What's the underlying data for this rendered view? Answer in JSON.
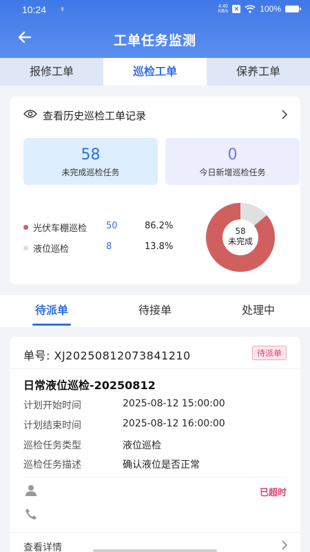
{
  "status_bar": {
    "time": "10:24",
    "symbol": "♆",
    "net_speed_value": "4.40",
    "net_speed_unit": "KB/s",
    "battery": "100%"
  },
  "header": {
    "title": "工单任务监测"
  },
  "top_tabs": [
    {
      "label": "报修工单",
      "active": false
    },
    {
      "label": "巡检工单",
      "active": true
    },
    {
      "label": "保养工单",
      "active": false
    }
  ],
  "overview": {
    "history_link": "查看历史巡检工单记录",
    "stats": [
      {
        "value": "58",
        "label": "未完成巡检任务"
      },
      {
        "value": "0",
        "label": "今日新增巡检任务"
      }
    ],
    "legend": [
      {
        "name": "光伏车棚巡检",
        "count": "50",
        "percent": "86.2%",
        "color": "#d0605e"
      },
      {
        "name": "液位巡检",
        "count": "8",
        "percent": "13.8%",
        "color": "#dddddd"
      }
    ],
    "donut": {
      "total": "58",
      "label": "未完成",
      "fraction_main": 0.862
    }
  },
  "sub_tabs": [
    {
      "label": "待派单",
      "active": true
    },
    {
      "label": "待接单",
      "active": false
    },
    {
      "label": "处理中",
      "active": false
    }
  ],
  "order": {
    "number_label": "单号:",
    "number": "XJ20250812073841210",
    "badge": "待派单",
    "title": "日常液位巡检-20250812",
    "fields": [
      {
        "key": "计划开始时间",
        "value": "2025-08-12 15:00:00"
      },
      {
        "key": "计划结束时间",
        "value": "2025-08-12 16:00:00"
      },
      {
        "key": "巡检任务类型",
        "value": "液位巡检"
      },
      {
        "key": "巡检任务描述",
        "value": "确认液位是否正常"
      }
    ],
    "status": "已超时",
    "detail_link": "查看详情"
  }
}
